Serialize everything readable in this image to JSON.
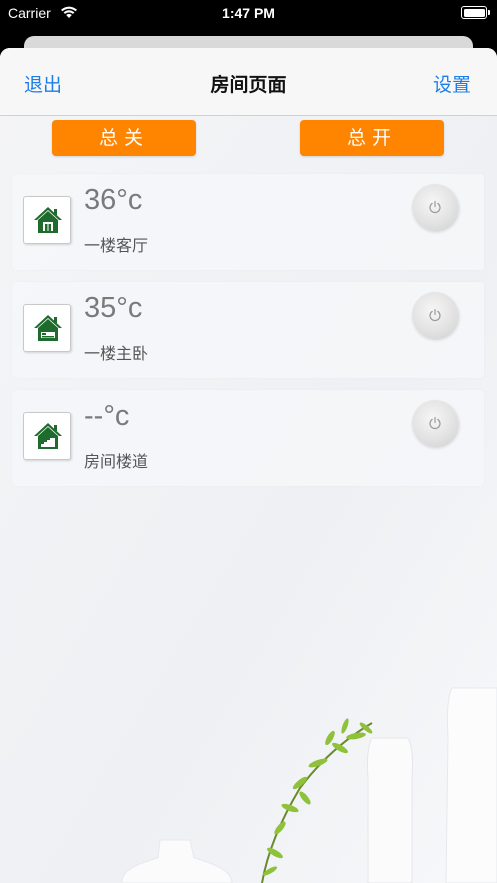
{
  "status_bar": {
    "carrier": "Carrier",
    "time": "1:47 PM"
  },
  "nav": {
    "left": "退出",
    "title": "房间页面",
    "right": "设置"
  },
  "controls": {
    "all_off": "总关",
    "all_on": "总开"
  },
  "rooms": [
    {
      "temp": "36°c",
      "name": "一楼客厅",
      "icon": "house-icon"
    },
    {
      "temp": "35°c",
      "name": "一楼主卧",
      "icon": "house-bed-icon"
    },
    {
      "temp": "--°c",
      "name": "房间楼道",
      "icon": "house-stairs-icon"
    }
  ],
  "colors": {
    "accent_orange": "#ff8400",
    "nav_blue": "#1e7ee6",
    "icon_green": "#1f6b2e"
  }
}
